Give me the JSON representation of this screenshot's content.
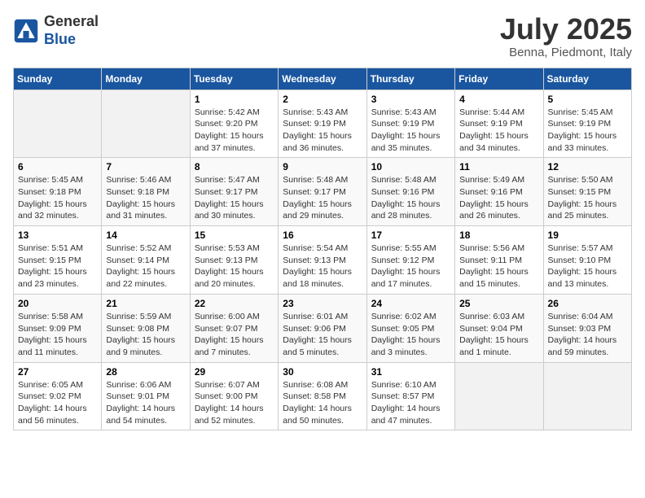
{
  "header": {
    "logo_general": "General",
    "logo_blue": "Blue",
    "month": "July 2025",
    "location": "Benna, Piedmont, Italy"
  },
  "weekdays": [
    "Sunday",
    "Monday",
    "Tuesday",
    "Wednesday",
    "Thursday",
    "Friday",
    "Saturday"
  ],
  "weeks": [
    [
      {
        "day": "",
        "sunrise": "",
        "sunset": "",
        "daylight": ""
      },
      {
        "day": "",
        "sunrise": "",
        "sunset": "",
        "daylight": ""
      },
      {
        "day": "1",
        "sunrise": "Sunrise: 5:42 AM",
        "sunset": "Sunset: 9:20 PM",
        "daylight": "Daylight: 15 hours and 37 minutes."
      },
      {
        "day": "2",
        "sunrise": "Sunrise: 5:43 AM",
        "sunset": "Sunset: 9:19 PM",
        "daylight": "Daylight: 15 hours and 36 minutes."
      },
      {
        "day": "3",
        "sunrise": "Sunrise: 5:43 AM",
        "sunset": "Sunset: 9:19 PM",
        "daylight": "Daylight: 15 hours and 35 minutes."
      },
      {
        "day": "4",
        "sunrise": "Sunrise: 5:44 AM",
        "sunset": "Sunset: 9:19 PM",
        "daylight": "Daylight: 15 hours and 34 minutes."
      },
      {
        "day": "5",
        "sunrise": "Sunrise: 5:45 AM",
        "sunset": "Sunset: 9:19 PM",
        "daylight": "Daylight: 15 hours and 33 minutes."
      }
    ],
    [
      {
        "day": "6",
        "sunrise": "Sunrise: 5:45 AM",
        "sunset": "Sunset: 9:18 PM",
        "daylight": "Daylight: 15 hours and 32 minutes."
      },
      {
        "day": "7",
        "sunrise": "Sunrise: 5:46 AM",
        "sunset": "Sunset: 9:18 PM",
        "daylight": "Daylight: 15 hours and 31 minutes."
      },
      {
        "day": "8",
        "sunrise": "Sunrise: 5:47 AM",
        "sunset": "Sunset: 9:17 PM",
        "daylight": "Daylight: 15 hours and 30 minutes."
      },
      {
        "day": "9",
        "sunrise": "Sunrise: 5:48 AM",
        "sunset": "Sunset: 9:17 PM",
        "daylight": "Daylight: 15 hours and 29 minutes."
      },
      {
        "day": "10",
        "sunrise": "Sunrise: 5:48 AM",
        "sunset": "Sunset: 9:16 PM",
        "daylight": "Daylight: 15 hours and 28 minutes."
      },
      {
        "day": "11",
        "sunrise": "Sunrise: 5:49 AM",
        "sunset": "Sunset: 9:16 PM",
        "daylight": "Daylight: 15 hours and 26 minutes."
      },
      {
        "day": "12",
        "sunrise": "Sunrise: 5:50 AM",
        "sunset": "Sunset: 9:15 PM",
        "daylight": "Daylight: 15 hours and 25 minutes."
      }
    ],
    [
      {
        "day": "13",
        "sunrise": "Sunrise: 5:51 AM",
        "sunset": "Sunset: 9:15 PM",
        "daylight": "Daylight: 15 hours and 23 minutes."
      },
      {
        "day": "14",
        "sunrise": "Sunrise: 5:52 AM",
        "sunset": "Sunset: 9:14 PM",
        "daylight": "Daylight: 15 hours and 22 minutes."
      },
      {
        "day": "15",
        "sunrise": "Sunrise: 5:53 AM",
        "sunset": "Sunset: 9:13 PM",
        "daylight": "Daylight: 15 hours and 20 minutes."
      },
      {
        "day": "16",
        "sunrise": "Sunrise: 5:54 AM",
        "sunset": "Sunset: 9:13 PM",
        "daylight": "Daylight: 15 hours and 18 minutes."
      },
      {
        "day": "17",
        "sunrise": "Sunrise: 5:55 AM",
        "sunset": "Sunset: 9:12 PM",
        "daylight": "Daylight: 15 hours and 17 minutes."
      },
      {
        "day": "18",
        "sunrise": "Sunrise: 5:56 AM",
        "sunset": "Sunset: 9:11 PM",
        "daylight": "Daylight: 15 hours and 15 minutes."
      },
      {
        "day": "19",
        "sunrise": "Sunrise: 5:57 AM",
        "sunset": "Sunset: 9:10 PM",
        "daylight": "Daylight: 15 hours and 13 minutes."
      }
    ],
    [
      {
        "day": "20",
        "sunrise": "Sunrise: 5:58 AM",
        "sunset": "Sunset: 9:09 PM",
        "daylight": "Daylight: 15 hours and 11 minutes."
      },
      {
        "day": "21",
        "sunrise": "Sunrise: 5:59 AM",
        "sunset": "Sunset: 9:08 PM",
        "daylight": "Daylight: 15 hours and 9 minutes."
      },
      {
        "day": "22",
        "sunrise": "Sunrise: 6:00 AM",
        "sunset": "Sunset: 9:07 PM",
        "daylight": "Daylight: 15 hours and 7 minutes."
      },
      {
        "day": "23",
        "sunrise": "Sunrise: 6:01 AM",
        "sunset": "Sunset: 9:06 PM",
        "daylight": "Daylight: 15 hours and 5 minutes."
      },
      {
        "day": "24",
        "sunrise": "Sunrise: 6:02 AM",
        "sunset": "Sunset: 9:05 PM",
        "daylight": "Daylight: 15 hours and 3 minutes."
      },
      {
        "day": "25",
        "sunrise": "Sunrise: 6:03 AM",
        "sunset": "Sunset: 9:04 PM",
        "daylight": "Daylight: 15 hours and 1 minute."
      },
      {
        "day": "26",
        "sunrise": "Sunrise: 6:04 AM",
        "sunset": "Sunset: 9:03 PM",
        "daylight": "Daylight: 14 hours and 59 minutes."
      }
    ],
    [
      {
        "day": "27",
        "sunrise": "Sunrise: 6:05 AM",
        "sunset": "Sunset: 9:02 PM",
        "daylight": "Daylight: 14 hours and 56 minutes."
      },
      {
        "day": "28",
        "sunrise": "Sunrise: 6:06 AM",
        "sunset": "Sunset: 9:01 PM",
        "daylight": "Daylight: 14 hours and 54 minutes."
      },
      {
        "day": "29",
        "sunrise": "Sunrise: 6:07 AM",
        "sunset": "Sunset: 9:00 PM",
        "daylight": "Daylight: 14 hours and 52 minutes."
      },
      {
        "day": "30",
        "sunrise": "Sunrise: 6:08 AM",
        "sunset": "Sunset: 8:58 PM",
        "daylight": "Daylight: 14 hours and 50 minutes."
      },
      {
        "day": "31",
        "sunrise": "Sunrise: 6:10 AM",
        "sunset": "Sunset: 8:57 PM",
        "daylight": "Daylight: 14 hours and 47 minutes."
      },
      {
        "day": "",
        "sunrise": "",
        "sunset": "",
        "daylight": ""
      },
      {
        "day": "",
        "sunrise": "",
        "sunset": "",
        "daylight": ""
      }
    ]
  ]
}
